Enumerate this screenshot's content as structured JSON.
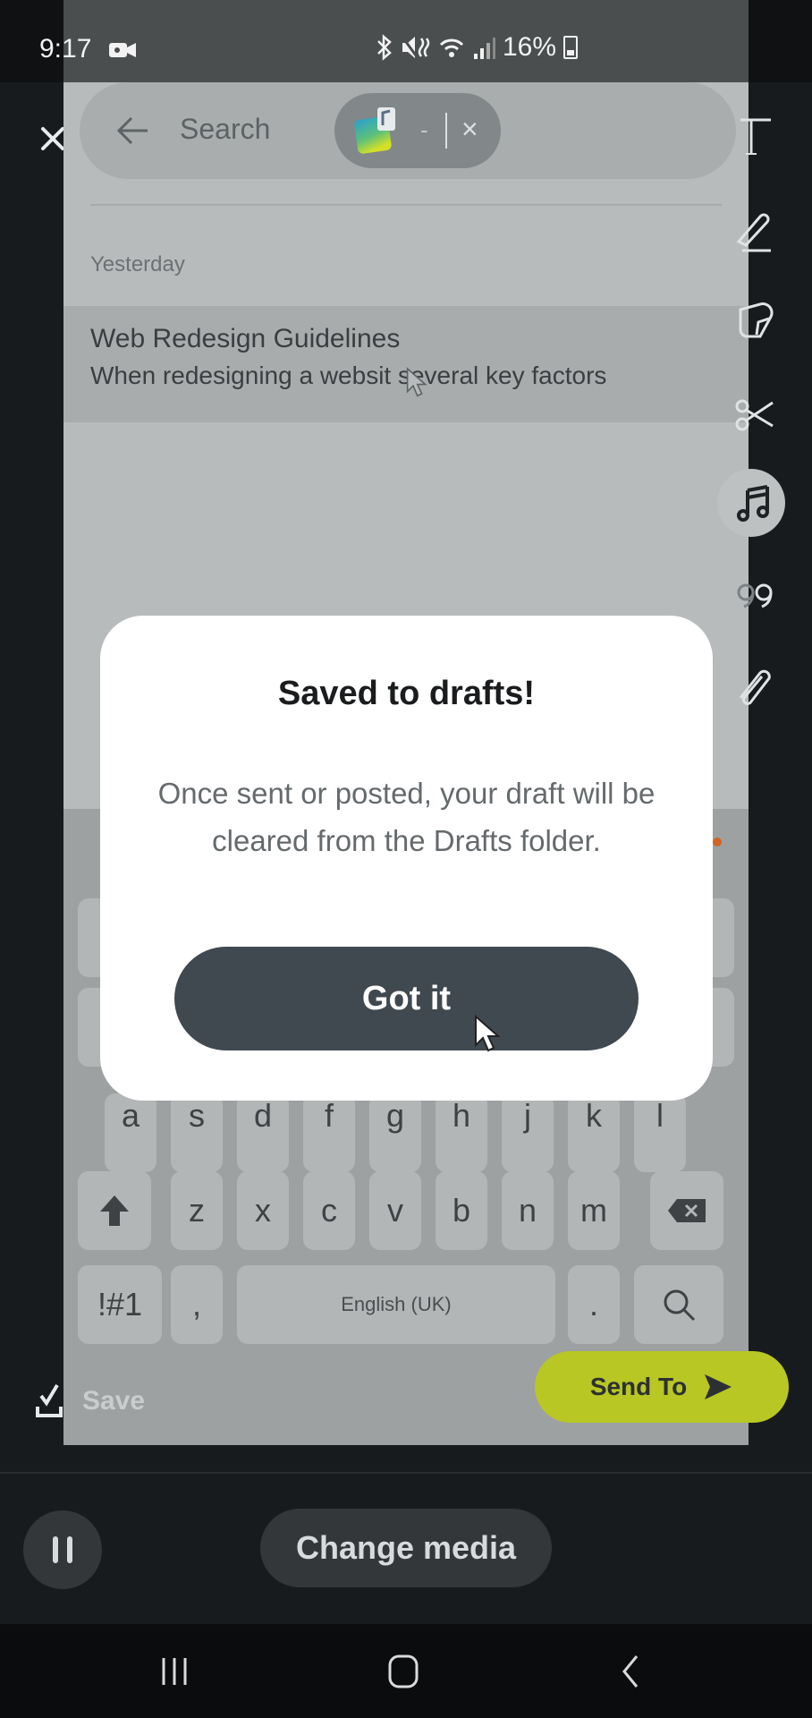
{
  "status_bar": {
    "time": "9:17",
    "battery": "16%",
    "icons": [
      "video-camera-icon",
      "bluetooth-icon",
      "mute-vibrate-icon",
      "wifi-icon",
      "signal-icon",
      "battery-charging-icon"
    ]
  },
  "preview": {
    "search": {
      "placeholder": "Search",
      "chip_dash": "-",
      "chip_close": "×"
    },
    "section_label": "Yesterday",
    "note": {
      "title": "Web Redesign Guidelines",
      "body": "When redesigning a websit    several key factors"
    },
    "keyboard": {
      "row_home": [
        "a",
        "s",
        "d",
        "f",
        "g",
        "h",
        "j",
        "k",
        "l"
      ],
      "row_bottom": [
        "z",
        "x",
        "c",
        "v",
        "b",
        "n",
        "m"
      ],
      "symbols_key": "!#1",
      "comma_key": ",",
      "space_label": "English (UK)",
      "period_key": "."
    }
  },
  "editor": {
    "save_label": "Save",
    "send_label": "Send To",
    "send_color": "#b8c723",
    "tools": [
      "text-tool",
      "pencil-tool",
      "sticker-tool",
      "scissors-tool",
      "music-tool",
      "quote-tool",
      "attachment-tool"
    ],
    "active_tool": "music-tool"
  },
  "dialog": {
    "title": "Saved to drafts!",
    "body": "Once sent or posted, your draft will be cleared from the Drafts folder.",
    "button_label": "Got it",
    "button_color": "#414950"
  },
  "bottom_controls": {
    "change_media_label": "Change media"
  }
}
